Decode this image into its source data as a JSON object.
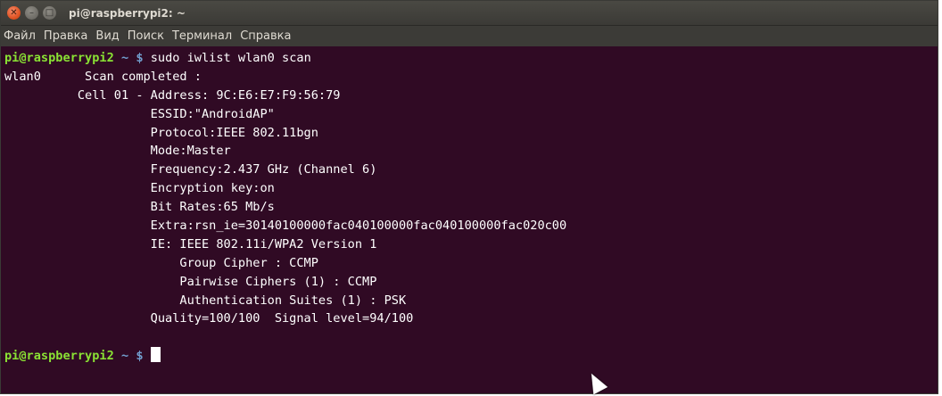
{
  "window": {
    "title": "pi@raspberrypi2: ~",
    "controls": [
      "close-icon",
      "minimize-icon",
      "maximize-icon"
    ]
  },
  "menubar": {
    "items": [
      "Файл",
      "Правка",
      "Вид",
      "Поиск",
      "Терминал",
      "Справка"
    ]
  },
  "terminal": {
    "prompt_user_host": "pi@raspberrypi2",
    "prompt_path": " ~ $",
    "command": " sudo iwlist wlan0 scan",
    "interface": "wlan0",
    "output": [
      "      Scan completed :",
      "          Cell 01 - Address: 9C:E6:E7:F9:56:79",
      "                    ESSID:\"AndroidAP\"",
      "                    Protocol:IEEE 802.11bgn",
      "                    Mode:Master",
      "                    Frequency:2.437 GHz (Channel 6)",
      "                    Encryption key:on",
      "                    Bit Rates:65 Mb/s",
      "                    Extra:rsn_ie=30140100000fac040100000fac040100000fac020c00",
      "                    IE: IEEE 802.11i/WPA2 Version 1",
      "                        Group Cipher : CCMP",
      "                        Pairwise Ciphers (1) : CCMP",
      "                        Authentication Suites (1) : PSK",
      "                    Quality=100/100  Signal level=94/100"
    ],
    "second_prompt_user_host": "pi@raspberrypi2",
    "second_prompt_path": " ~ $"
  },
  "colors": {
    "terminal_bg": "#300a24",
    "prompt_user": "#8ae234",
    "prompt_path": "#729fcf",
    "close_button": "#e05424"
  }
}
